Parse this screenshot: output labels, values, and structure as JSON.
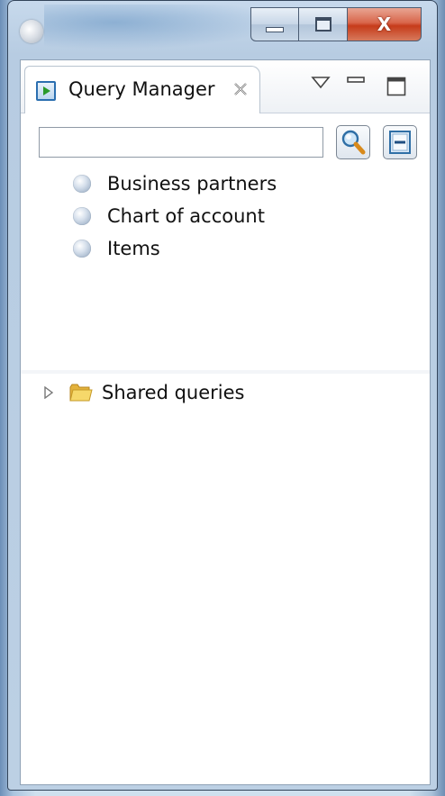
{
  "window": {
    "controls": {
      "minimize": "minimize",
      "maximize": "maximize",
      "close": "close"
    }
  },
  "view": {
    "tab_title": "Query Manager",
    "icons": {
      "tab_close": "close-icon",
      "view_menu": "chevron-down-icon",
      "minimize": "minimize-icon",
      "maximize": "maximize-icon"
    }
  },
  "search": {
    "value": "",
    "placeholder": "",
    "search_icon": "search-icon",
    "collapse_icon": "collapse-all-icon"
  },
  "queries": {
    "items": [
      {
        "label": "Business partners",
        "icon": "query-bullet-icon"
      },
      {
        "label": "Chart of account",
        "icon": "query-bullet-icon"
      },
      {
        "label": "Items",
        "icon": "query-bullet-icon"
      }
    ]
  },
  "tree": {
    "nodes": [
      {
        "label": "Shared queries",
        "icon": "folder-icon",
        "expanded": false
      }
    ]
  },
  "colors": {
    "close_button": "#c63b1a",
    "frame": "#bcd0e4",
    "tab_icon": "#2b6fb0",
    "folder": "#f2c94c"
  }
}
